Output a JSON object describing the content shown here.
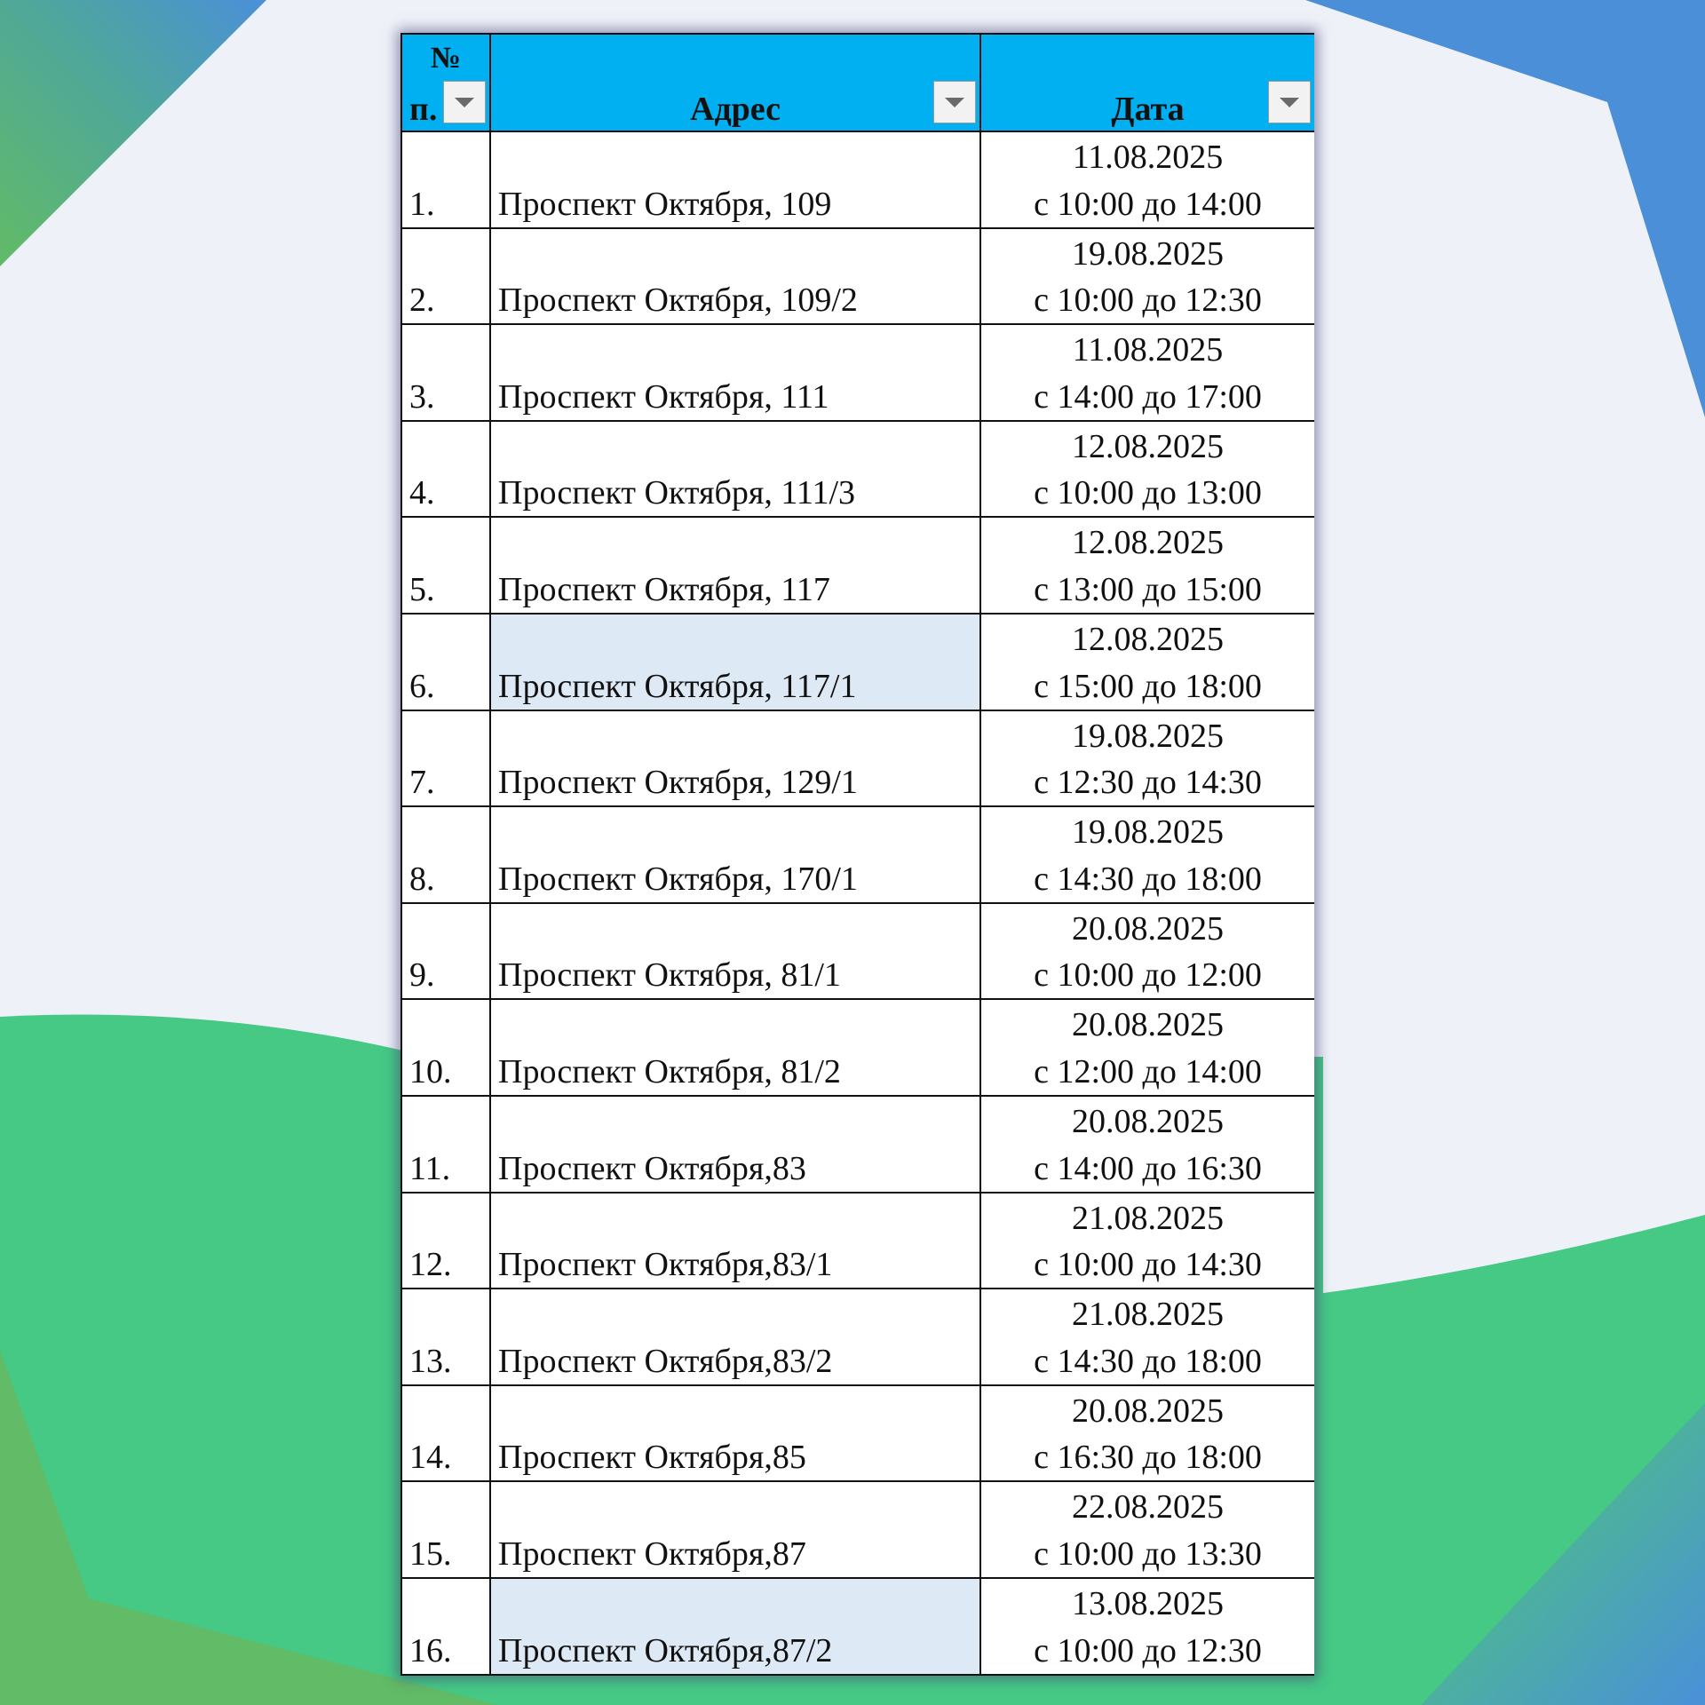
{
  "colors": {
    "header_fill": "#00b0f0",
    "highlight_fill": "#dde9f5",
    "background": "#eef2f8",
    "green": "#45c985",
    "blue": "#4a8fd8"
  },
  "header": {
    "num_top": "№",
    "num_bottom": "п.",
    "address": "Адрес",
    "date": "Дата",
    "filter_icon": "dropdown-arrow-icon"
  },
  "rows": [
    {
      "num": "1.",
      "address": "Проспект Октября, 109",
      "date": "11.08.2025",
      "time": "с  10:00 до 14:00",
      "highlight": false
    },
    {
      "num": "2.",
      "address": "Проспект Октября, 109/2",
      "date": "19.08.2025",
      "time": "с  10:00 до 12:30",
      "highlight": false
    },
    {
      "num": "3.",
      "address": "Проспект Октября, 111",
      "date": "11.08.2025",
      "time": "с  14:00 до 17:00",
      "highlight": false
    },
    {
      "num": "4.",
      "address": "Проспект Октября, 111/3",
      "date": "12.08.2025",
      "time": "с  10:00 до 13:00",
      "highlight": false
    },
    {
      "num": "5.",
      "address": "Проспект Октября, 117",
      "date": "12.08.2025",
      "time": "с  13:00 до 15:00",
      "highlight": false
    },
    {
      "num": "6.",
      "address": "Проспект Октября, 117/1",
      "date": "12.08.2025",
      "time": "с  15:00 до 18:00",
      "highlight": true
    },
    {
      "num": "7.",
      "address": "Проспект Октября, 129/1",
      "date": "19.08.2025",
      "time": "с  12:30 до 14:30",
      "highlight": false
    },
    {
      "num": "8.",
      "address": "Проспект Октября, 170/1",
      "date": "19.08.2025",
      "time": "с  14:30 до 18:00",
      "highlight": false
    },
    {
      "num": "9.",
      "address": "Проспект Октября, 81/1",
      "date": "20.08.2025",
      "time": "с  10:00 до 12:00",
      "highlight": false
    },
    {
      "num": "10.",
      "address": "Проспект Октября, 81/2",
      "date": "20.08.2025",
      "time": "с  12:00 до 14:00",
      "highlight": false
    },
    {
      "num": "11.",
      "address": "Проспект Октября,83",
      "date": "20.08.2025",
      "time": "с  14:00 до 16:30",
      "highlight": false
    },
    {
      "num": "12.",
      "address": "Проспект Октября,83/1",
      "date": "21.08.2025",
      "time": "с  10:00 до 14:30",
      "highlight": false
    },
    {
      "num": "13.",
      "address": "Проспект Октября,83/2",
      "date": "21.08.2025",
      "time": "с  14:30 до 18:00",
      "highlight": false
    },
    {
      "num": "14.",
      "address": "Проспект Октября,85",
      "date": "20.08.2025",
      "time": "с  16:30 до 18:00",
      "highlight": false
    },
    {
      "num": "15.",
      "address": "Проспект Октября,87",
      "date": "22.08.2025",
      "time": "с  10:00 до 13:30",
      "highlight": false
    },
    {
      "num": "16.",
      "address": "Проспект Октября,87/2",
      "date": "13.08.2025",
      "time": "с  10:00 до 12:30",
      "highlight": true
    }
  ]
}
